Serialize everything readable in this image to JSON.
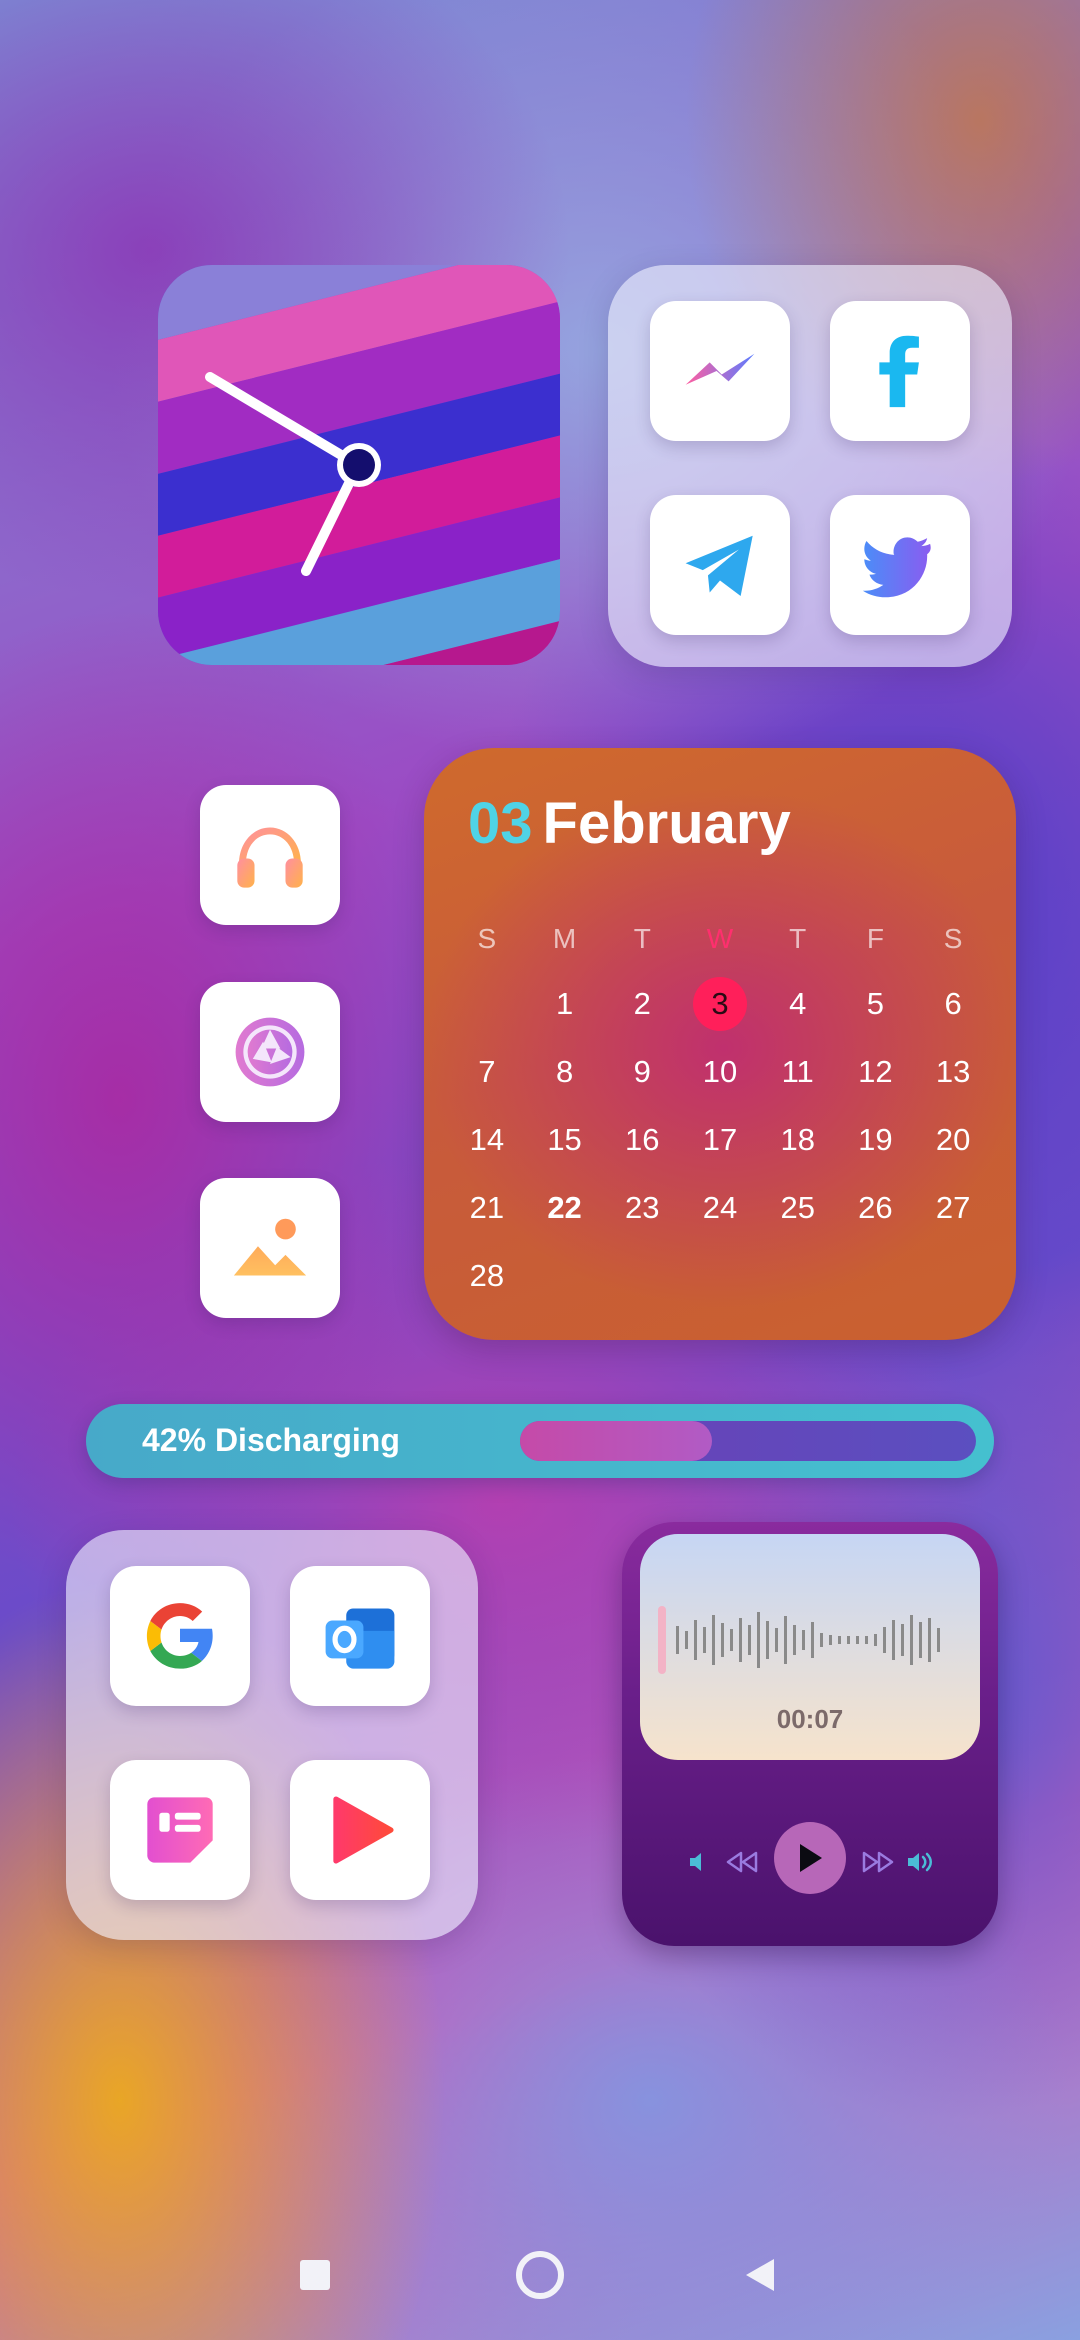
{
  "clock": {
    "hour_angle_deg": 210,
    "minute_angle_deg": 300
  },
  "social_folder": {
    "apps": [
      {
        "name": "Messenger",
        "icon": "messenger-icon"
      },
      {
        "name": "Facebook",
        "icon": "facebook-icon"
      },
      {
        "name": "Telegram",
        "icon": "telegram-icon"
      },
      {
        "name": "Twitter",
        "icon": "twitter-icon"
      }
    ]
  },
  "side_apps": [
    {
      "name": "Music",
      "icon": "headphones-icon"
    },
    {
      "name": "Camera",
      "icon": "camera-aperture-icon"
    },
    {
      "name": "Gallery",
      "icon": "gallery-icon"
    }
  ],
  "calendar": {
    "day": "03",
    "month": "February",
    "weekdays": [
      "S",
      "M",
      "T",
      "W",
      "T",
      "F",
      "S"
    ],
    "today_column": 3,
    "leading_blanks": 1,
    "days": [
      "1",
      "2",
      "3",
      "4",
      "5",
      "6",
      "7",
      "8",
      "9",
      "10",
      "11",
      "12",
      "13",
      "14",
      "15",
      "16",
      "17",
      "18",
      "19",
      "20",
      "21",
      "22",
      "23",
      "24",
      "25",
      "26",
      "27",
      "28"
    ],
    "today": "3",
    "bold_day": "22",
    "colors": {
      "day_number": "#4fd3e6",
      "today_bg": "#ff1f5a"
    }
  },
  "battery": {
    "label": "42% Discharging",
    "level": 0.42
  },
  "google_folder": {
    "apps": [
      {
        "name": "Google",
        "icon": "google-icon"
      },
      {
        "name": "Outlook",
        "icon": "outlook-icon"
      },
      {
        "name": "Notes",
        "icon": "notes-icon"
      },
      {
        "name": "Play",
        "icon": "play-icon"
      }
    ]
  },
  "music": {
    "time": "00:07",
    "controls": [
      "volume-down-icon",
      "rewind-icon",
      "play-icon",
      "fast-forward-icon",
      "volume-up-icon"
    ]
  },
  "nav": [
    "recents-icon",
    "home-icon",
    "back-icon"
  ]
}
